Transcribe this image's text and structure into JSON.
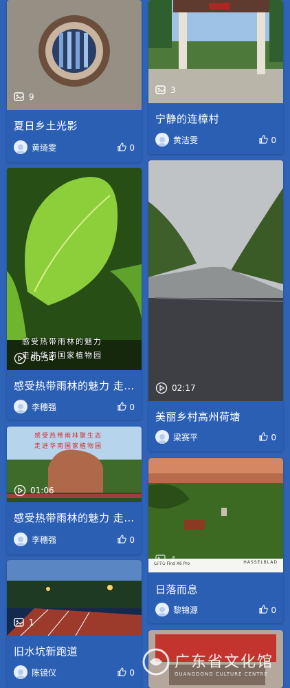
{
  "cards": [
    {
      "title": "夏日乡土光影",
      "author": "黄绮雯",
      "likes": "0",
      "media_count": "9",
      "media_type": "photos"
    },
    {
      "title": "宁静的连樟村",
      "author": "黄洁雯",
      "likes": "0",
      "media_count": "3",
      "media_type": "photos"
    },
    {
      "title": "感受热带雨林的魅力 走进华南国家植物园",
      "author": "李穗强",
      "likes": "0",
      "duration": "00:54",
      "media_type": "video",
      "overlay_line1": "感受热带雨林的魅力",
      "overlay_line2": "走进华南国家植物园"
    },
    {
      "title": "美丽乡村高州荷塘",
      "author": "梁赛平",
      "likes": "0",
      "duration": "02:17",
      "media_type": "video"
    },
    {
      "title": "感受热带雨林的魅力 走进华南国家植物园",
      "author": "李穗强",
      "likes": "0",
      "duration": "01:06",
      "media_type": "video",
      "overlay_line1": "感受热带雨林聚生态",
      "overlay_line2": "走进华南国家植物园"
    },
    {
      "title": "日落而息",
      "author": "黎锦源",
      "likes": "0",
      "media_count": "4",
      "media_type": "photos",
      "photo_caption_left": "OPPO Find X6 Pro",
      "photo_caption_brand": "HASSELBLAD"
    },
    {
      "title": "旧水坑新跑道",
      "author": "陈镜仪",
      "likes": "0",
      "media_count": "1",
      "media_type": "photos"
    },
    {
      "title": "",
      "author": "",
      "likes": "",
      "media_type": "photos"
    }
  ],
  "watermark": {
    "cn": "广东省文化馆",
    "en": "GUANGDONG CULTURE CENTRE"
  },
  "icons": {
    "photos": "image-stack-icon",
    "video": "play-circle-icon",
    "like": "thumbs-up-icon",
    "avatar": "user-avatar-icon"
  }
}
